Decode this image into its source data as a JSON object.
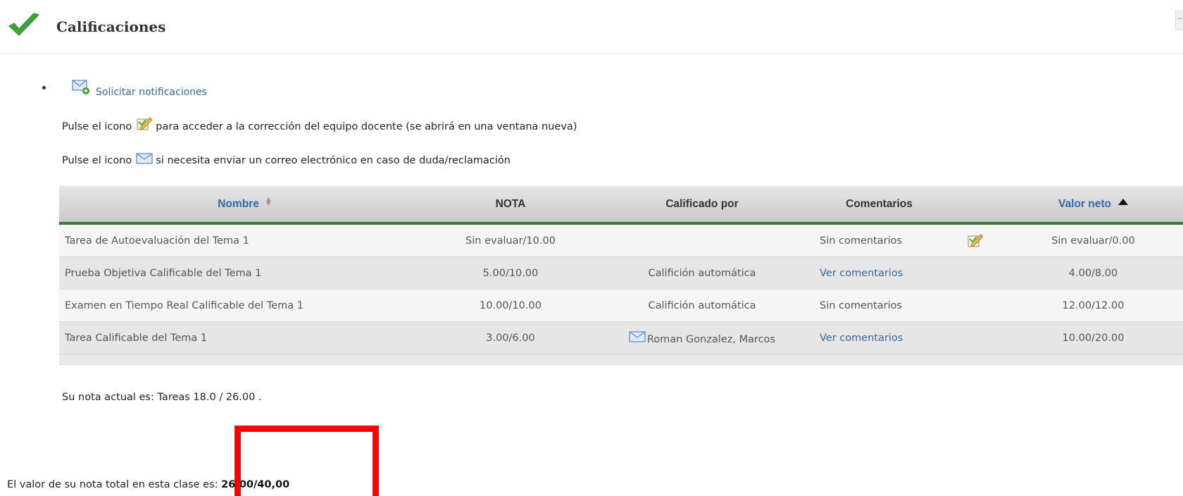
{
  "header": {
    "title": "Calificaciones",
    "icon": "check-icon"
  },
  "notifications": {
    "link_label": "Solicitar notificaciones"
  },
  "instructions": {
    "line1_prefix": "Pulse el icono",
    "line1_suffix": "para acceder a la corrección del equipo docente (se abrirá en una ventana nueva)",
    "line2_prefix": "Pulse el icono",
    "line2_suffix": "si necesita enviar un correo electrónico en caso de duda/reclamación"
  },
  "table": {
    "headers": {
      "name": "Nombre",
      "grade": "NOTA",
      "graded_by": "Calificado por",
      "comments": "Comentarios",
      "net_value": "Valor neto"
    },
    "rows": [
      {
        "name": "Tarea de Autoevaluación del Tema 1",
        "grade": "Sin evaluar/10.00",
        "graded_by": "",
        "comments": "Sin comentarios",
        "net_value": "Sin evaluar/0.00"
      },
      {
        "name": "Prueba Objetiva Calificable del Tema 1",
        "grade": "5.00/10.00",
        "graded_by": "Califición automática",
        "comments": "Ver comentarios",
        "net_value": "4.00/8.00"
      },
      {
        "name": "Examen en Tiempo Real Calificable del Tema 1",
        "grade": "10.00/10.00",
        "graded_by": "Califición automática",
        "comments": "Sin comentarios",
        "net_value": "12.00/12.00"
      },
      {
        "name": "Tarea Calificable del Tema 1",
        "grade": "3.00/6.00",
        "graded_by": "Roman Gonzalez, Marcos",
        "comments": "Ver comentarios",
        "net_value": "10.00/20.00"
      }
    ]
  },
  "summary": {
    "text": "Su nota actual es: Tareas 18.0 / 26.00 ."
  },
  "total": {
    "prefix": "El valor de su nota total en esta clase es:",
    "value": "26,00/40,00"
  },
  "colors": {
    "link": "#3366aa",
    "header_border": "#2e7d32",
    "highlight": "#ff0000"
  }
}
